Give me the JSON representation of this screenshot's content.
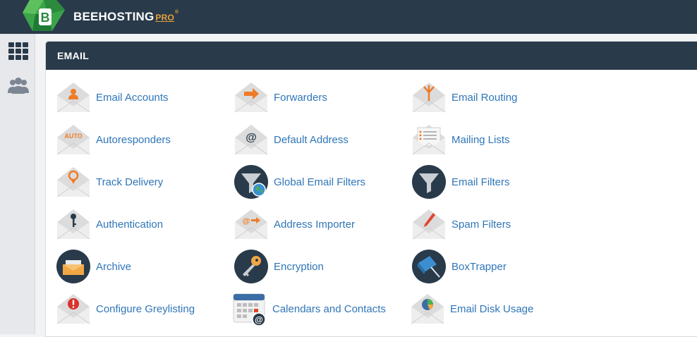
{
  "brand": {
    "name": "BEEHOSTING",
    "suffix": "PRO",
    "tm": "®"
  },
  "sidebar": {
    "items": [
      {
        "icon": "grid-icon"
      },
      {
        "icon": "users-icon"
      }
    ]
  },
  "panel": {
    "title": "EMAIL"
  },
  "items": [
    {
      "label": "Email Accounts",
      "icon": "user-envelope-icon"
    },
    {
      "label": "Forwarders",
      "icon": "arrow-envelope-icon"
    },
    {
      "label": "Email Routing",
      "icon": "routing-envelope-icon"
    },
    {
      "label": "Autoresponders",
      "icon": "auto-envelope-icon"
    },
    {
      "label": "Default Address",
      "icon": "at-envelope-icon"
    },
    {
      "label": "Mailing Lists",
      "icon": "list-envelope-icon"
    },
    {
      "label": "Track Delivery",
      "icon": "pin-envelope-icon"
    },
    {
      "label": "Global Email Filters",
      "icon": "globe-funnel-icon"
    },
    {
      "label": "Email Filters",
      "icon": "funnel-icon"
    },
    {
      "label": "Authentication",
      "icon": "key-envelope-icon"
    },
    {
      "label": "Address Importer",
      "icon": "at-arrow-envelope-icon"
    },
    {
      "label": "Spam Filters",
      "icon": "pen-envelope-icon"
    },
    {
      "label": "Archive",
      "icon": "archive-icon"
    },
    {
      "label": "Encryption",
      "icon": "key-circle-icon"
    },
    {
      "label": "BoxTrapper",
      "icon": "trap-icon"
    },
    {
      "label": "Configure Greylisting",
      "icon": "alert-envelope-icon"
    },
    {
      "label": "Calendars and Contacts",
      "icon": "calendar-icon"
    },
    {
      "label": "Email Disk Usage",
      "icon": "pie-envelope-icon"
    }
  ],
  "colors": {
    "header": "#293a4a",
    "link": "#2f76b8",
    "accent": "#ef7b28"
  }
}
